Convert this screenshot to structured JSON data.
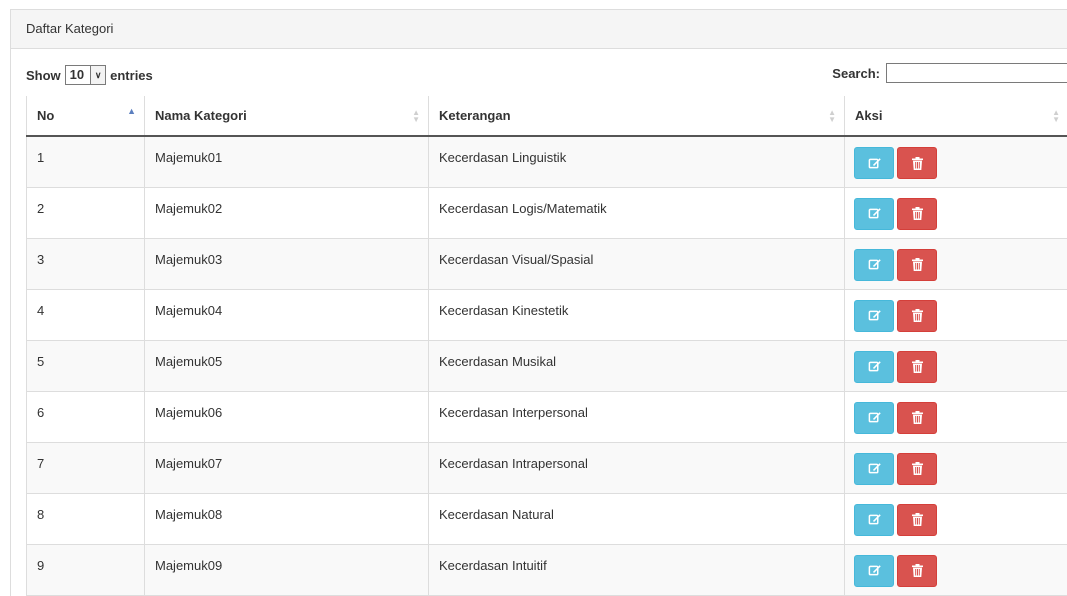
{
  "panel": {
    "title": "Daftar Kategori"
  },
  "length_menu": {
    "show_label": "Show",
    "value": "10",
    "entries_label": "entries"
  },
  "search": {
    "label": "Search:",
    "value": "",
    "placeholder": ""
  },
  "table": {
    "columns": [
      "No",
      "Nama Kategori",
      "Keterangan",
      "Aksi"
    ],
    "sorted_column": "No",
    "sort_direction": "ascending",
    "rows": [
      {
        "no": "1",
        "nama": "Majemuk01",
        "keterangan": "Kecerdasan Linguistik"
      },
      {
        "no": "2",
        "nama": "Majemuk02",
        "keterangan": "Kecerdasan Logis/Matematik"
      },
      {
        "no": "3",
        "nama": "Majemuk03",
        "keterangan": "Kecerdasan Visual/Spasial"
      },
      {
        "no": "4",
        "nama": "Majemuk04",
        "keterangan": "Kecerdasan Kinestetik"
      },
      {
        "no": "5",
        "nama": "Majemuk05",
        "keterangan": "Kecerdasan Musikal"
      },
      {
        "no": "6",
        "nama": "Majemuk06",
        "keterangan": "Kecerdasan Interpersonal"
      },
      {
        "no": "7",
        "nama": "Majemuk07",
        "keterangan": "Kecerdasan Intrapersonal"
      },
      {
        "no": "8",
        "nama": "Majemuk08",
        "keterangan": "Kecerdasan Natural"
      },
      {
        "no": "9",
        "nama": "Majemuk09",
        "keterangan": "Kecerdasan Intuitif"
      }
    ]
  },
  "actions": {
    "edit_icon": "edit-icon",
    "delete_icon": "trash-icon"
  },
  "colors": {
    "edit": "#5bc0de",
    "delete": "#d9534f",
    "stripe": "#f9f9f9"
  }
}
